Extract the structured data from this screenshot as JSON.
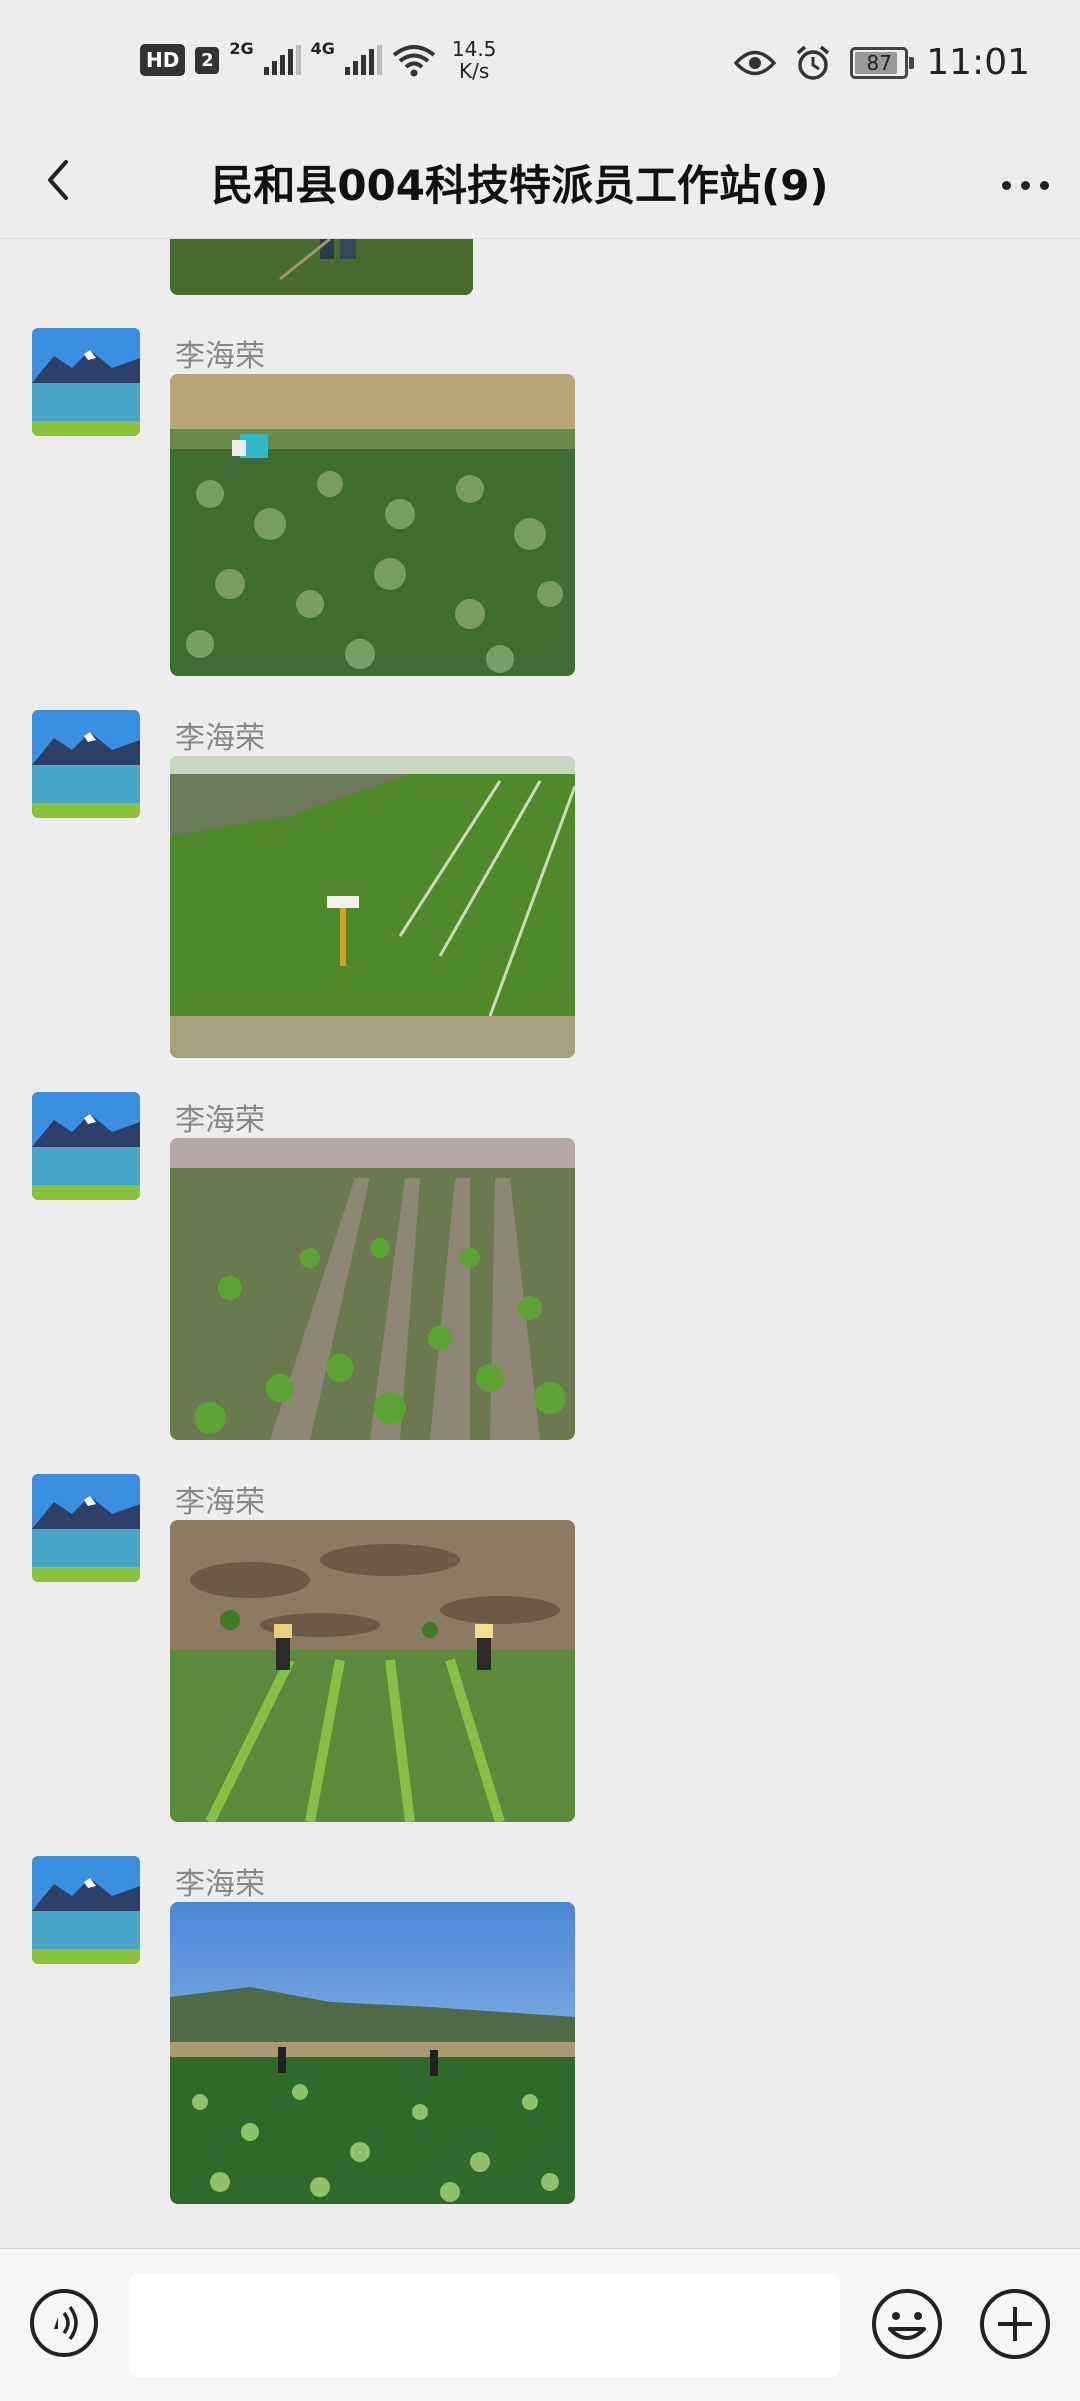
{
  "status_bar": {
    "hd_badge": "HD",
    "sim_badge": "2",
    "net1": "2G",
    "net2": "4G",
    "speed_value": "14.5",
    "speed_unit": "K/s",
    "battery": "87",
    "time": "11:01",
    "icons": [
      "eye-icon",
      "alarm-icon",
      "battery-icon",
      "wifi-icon",
      "signal-icon"
    ]
  },
  "header": {
    "title": "民和县004科技特派员工作站(9)",
    "back_icon": "chevron-left-icon",
    "more_icon": "more-dots-icon"
  },
  "messages": [
    {
      "sender": "",
      "photo": "field-photo"
    },
    {
      "sender": "李海荣",
      "photo": "field-photo"
    },
    {
      "sender": "李海荣",
      "photo": "field-photo"
    },
    {
      "sender": "李海荣",
      "photo": "field-photo"
    },
    {
      "sender": "李海荣",
      "photo": "field-photo"
    },
    {
      "sender": "李海荣",
      "photo": "field-photo"
    }
  ],
  "input_bar": {
    "placeholder": "",
    "icons": [
      "voice-icon",
      "emoji-icon",
      "plus-icon"
    ]
  },
  "colors": {
    "background": "#ededed",
    "sender_text": "#888888",
    "input_bar": "#f6f6f6"
  }
}
